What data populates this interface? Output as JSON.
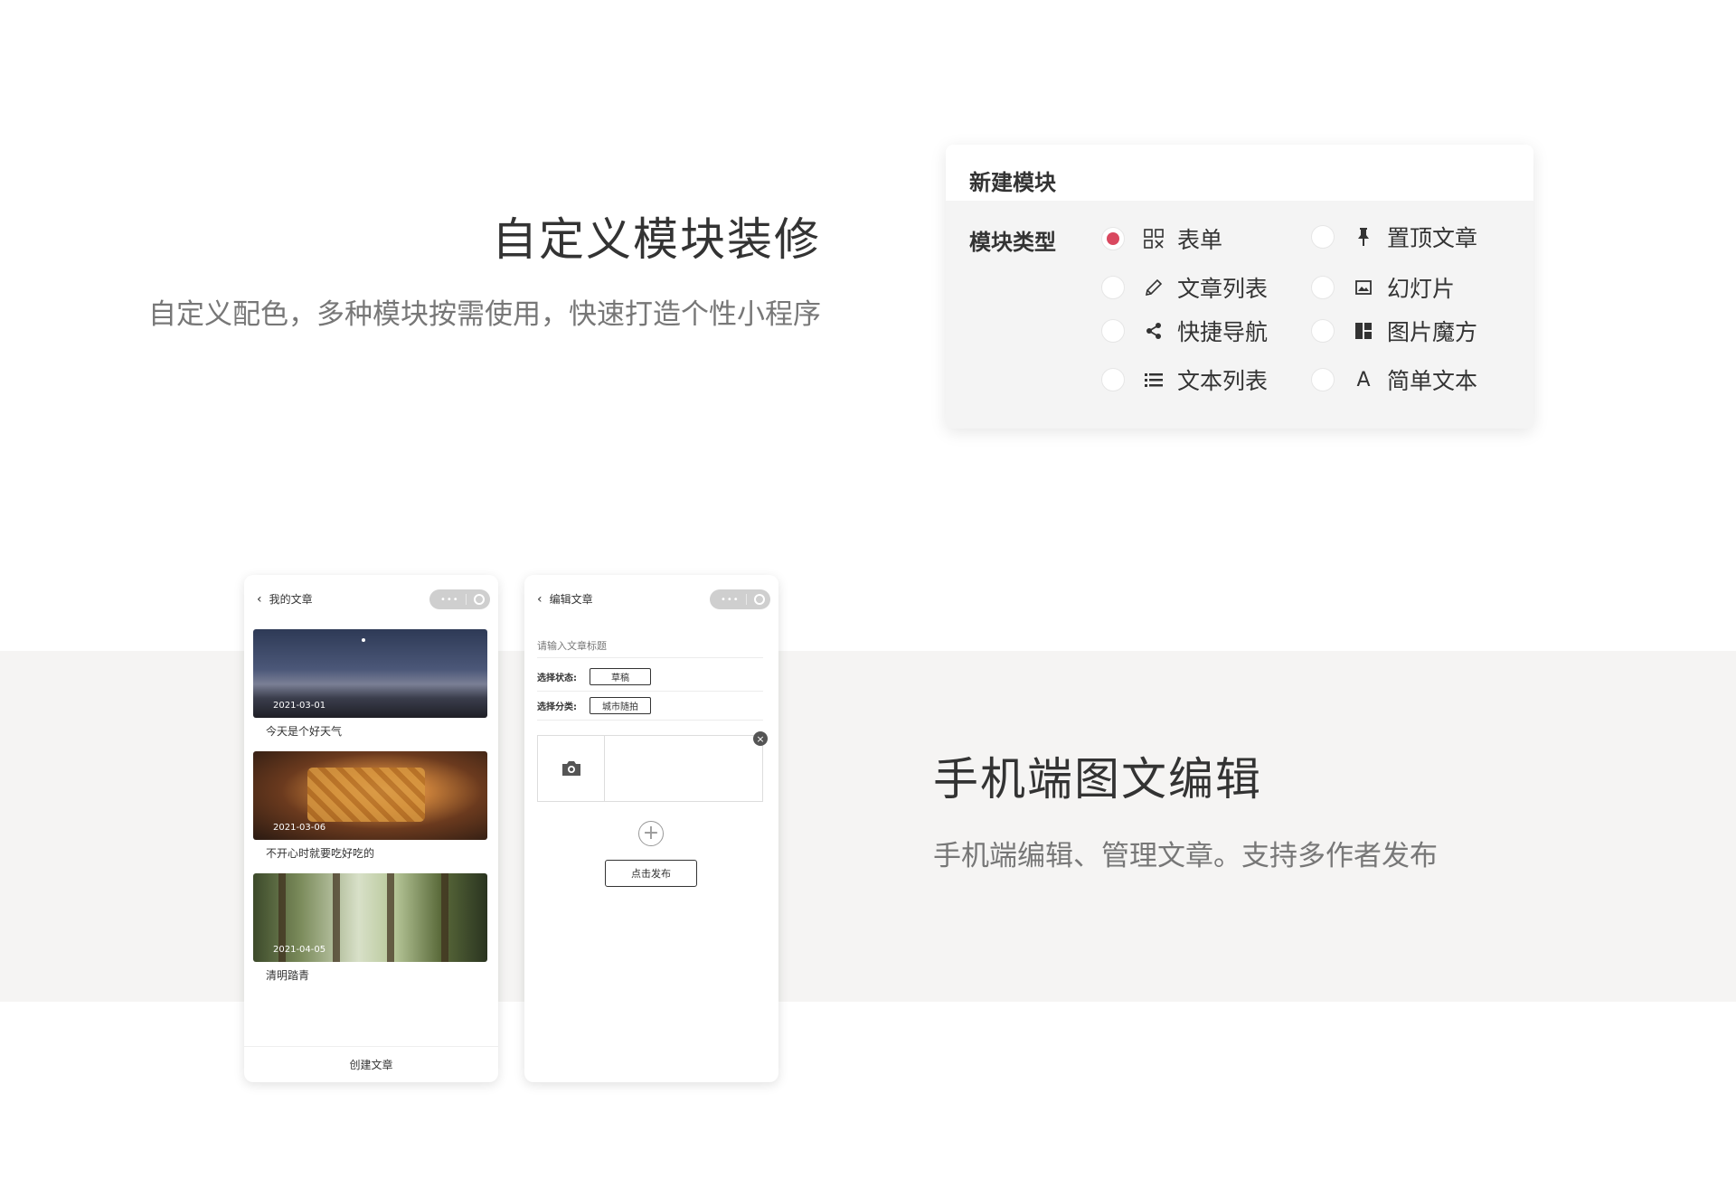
{
  "section1": {
    "title": "自定义模块装修",
    "subtitle": "自定义配色，多种模块按需使用，快速打造个性小程序"
  },
  "module_card": {
    "header": "新建模块",
    "type_label": "模块类型",
    "selected": "表单",
    "options": [
      {
        "label": "表单",
        "icon": "grid-form-icon",
        "selected": true
      },
      {
        "label": "置顶文章",
        "icon": "pin-icon",
        "selected": false
      },
      {
        "label": "文章列表",
        "icon": "pencil-icon",
        "selected": false
      },
      {
        "label": "幻灯片",
        "icon": "image-icon",
        "selected": false
      },
      {
        "label": "快捷导航",
        "icon": "share-icon",
        "selected": false
      },
      {
        "label": "图片魔方",
        "icon": "magic-cube-icon",
        "selected": false
      },
      {
        "label": "文本列表",
        "icon": "list-icon",
        "selected": false
      },
      {
        "label": "简单文本",
        "icon": "text-a-icon",
        "selected": false
      }
    ],
    "accent_color": "#d9485f"
  },
  "phone_list": {
    "nav_title": "我的文章",
    "articles": [
      {
        "date": "2021-03-01",
        "title": "今天是个好天气"
      },
      {
        "date": "2021-03-06",
        "title": "不开心时就要吃好吃的"
      },
      {
        "date": "2021-04-05",
        "title": "清明踏青"
      }
    ],
    "footer_button": "创建文章"
  },
  "phone_edit": {
    "nav_title": "编辑文章",
    "title_placeholder": "请输入文章标题",
    "status_label": "选择状态:",
    "status_value": "草稿",
    "category_label": "选择分类:",
    "category_value": "城市随拍",
    "publish_button": "点击发布"
  },
  "section2": {
    "title": "手机端图文编辑",
    "subtitle": "手机端编辑、管理文章。支持多作者发布"
  }
}
